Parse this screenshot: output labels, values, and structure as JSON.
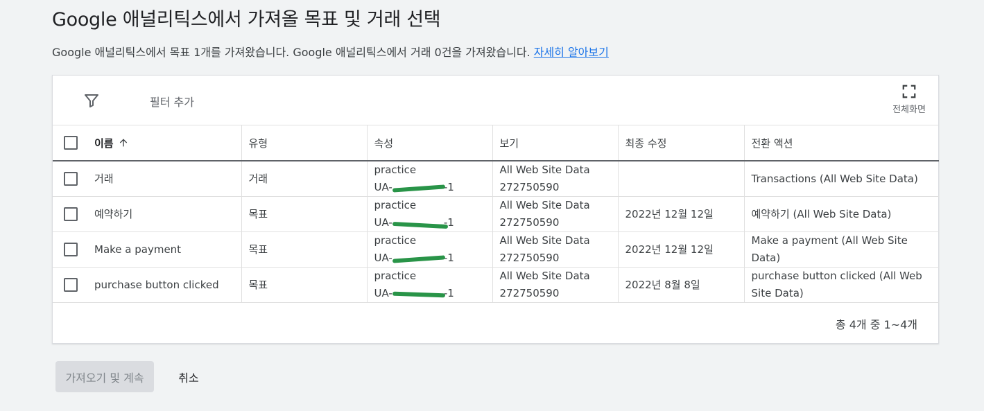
{
  "title": "Google 애널리틱스에서 가져올 목표 및 거래 선택",
  "description": {
    "text": "Google 애널리틱스에서 목표 1개를 가져왔습니다. Google 애널리틱스에서 거래 0건을 가져왔습니다. ",
    "link": "자세히 알아보기"
  },
  "toolbar": {
    "filter_icon": "filter-icon",
    "filter_label": "필터 추가",
    "fullscreen_icon": "fullscreen-icon",
    "fullscreen_label": "전체화면"
  },
  "table": {
    "columns": [
      "이름",
      "유형",
      "속성",
      "보기",
      "최종 수정",
      "전환 액션"
    ],
    "sort_icon": "arrow-up-icon",
    "rows": [
      {
        "name": "거래",
        "type": "거래",
        "property": "practice",
        "property_id": "UA-",
        "property_id_suffix": "-1",
        "view": "All Web Site Data",
        "view_id": "272750590",
        "modified": "",
        "action": "Transactions (All Web Site Data)"
      },
      {
        "name": "예약하기",
        "type": "목표",
        "property": "practice",
        "property_id": "UA-",
        "property_id_suffix": "-1",
        "view": "All Web Site Data",
        "view_id": "272750590",
        "modified": "2022년 12월 12일",
        "action": "예약하기 (All Web Site Data)"
      },
      {
        "name": "Make a payment",
        "type": "목표",
        "property": "practice",
        "property_id": "UA-",
        "property_id_suffix": "-1",
        "view": "All Web Site Data",
        "view_id": "272750590",
        "modified": "2022년 12월 12일",
        "action": "Make a payment (All Web Site Data)"
      },
      {
        "name": "purchase button clicked",
        "type": "목표",
        "property": "practice",
        "property_id": "UA-",
        "property_id_suffix": "-1",
        "view": "All Web Site Data",
        "view_id": "272750590",
        "modified": "2022년 8월 8일",
        "action": "purchase button clicked (All Web Site Data)"
      }
    ],
    "pagination": "총 4개 중 1~4개"
  },
  "buttons": {
    "import_label": "가져오기 및 계속",
    "cancel_label": "취소"
  },
  "colors": {
    "link": "#1a73e8",
    "redaction": "#1e8e3e",
    "background": "#f1f3f4"
  }
}
